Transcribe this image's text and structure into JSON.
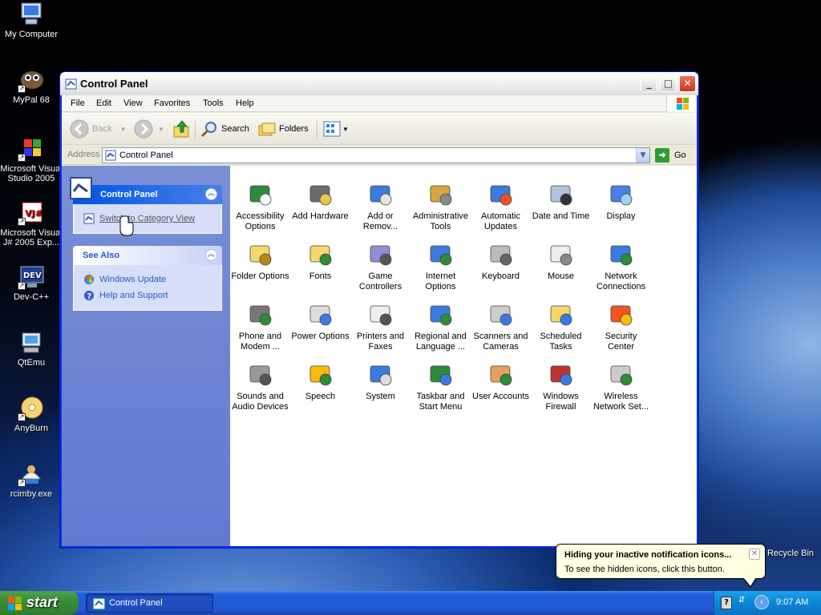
{
  "desktop": {
    "icons": [
      {
        "label": "My Computer",
        "icon": "computer-icon"
      },
      {
        "label": "MyPal 68",
        "icon": "mypal-icon"
      },
      {
        "label": "Microsoft Visual Studio 2005",
        "icon": "visual-studio-icon"
      },
      {
        "label": "Microsoft Visual J# 2005 Exp...",
        "icon": "visual-jsharp-icon"
      },
      {
        "label": "Dev-C++",
        "icon": "devcpp-icon"
      },
      {
        "label": "QtEmu",
        "icon": "qtemu-icon"
      },
      {
        "label": "AnyBurn",
        "icon": "anyburn-icon"
      },
      {
        "label": "rcimby.exe",
        "icon": "exe-icon"
      }
    ],
    "recycle_bin": "Recycle Bin"
  },
  "window": {
    "title": "Control Panel",
    "buttons": {
      "minimize": "_",
      "maximize": "□",
      "close": "✕"
    },
    "menu": [
      "File",
      "Edit",
      "View",
      "Favorites",
      "Tools",
      "Help"
    ],
    "toolbar": {
      "back": "Back",
      "search": "Search",
      "folders": "Folders"
    },
    "address": {
      "label": "Address",
      "value": "Control Panel",
      "go": "Go"
    }
  },
  "taskpane": {
    "control_panel": {
      "title": "Control Panel",
      "link": "Switch to Category View"
    },
    "see_also": {
      "title": "See Also",
      "links": [
        "Windows Update",
        "Help and Support"
      ]
    }
  },
  "items": [
    {
      "label": "Accessibility Options",
      "icon": "accessibility-icon"
    },
    {
      "label": "Add Hardware",
      "icon": "add-hardware-icon"
    },
    {
      "label": "Add or Remov...",
      "icon": "add-remove-programs-icon"
    },
    {
      "label": "Administrative Tools",
      "icon": "administrative-tools-icon"
    },
    {
      "label": "Automatic Updates",
      "icon": "automatic-updates-icon"
    },
    {
      "label": "Date and Time",
      "icon": "date-time-icon"
    },
    {
      "label": "Display",
      "icon": "display-icon"
    },
    {
      "label": "Folder Options",
      "icon": "folder-options-icon"
    },
    {
      "label": "Fonts",
      "icon": "fonts-icon"
    },
    {
      "label": "Game Controllers",
      "icon": "game-controllers-icon"
    },
    {
      "label": "Internet Options",
      "icon": "internet-options-icon"
    },
    {
      "label": "Keyboard",
      "icon": "keyboard-icon"
    },
    {
      "label": "Mouse",
      "icon": "mouse-icon"
    },
    {
      "label": "Network Connections",
      "icon": "network-connections-icon"
    },
    {
      "label": "Phone and Modem ...",
      "icon": "phone-modem-icon"
    },
    {
      "label": "Power Options",
      "icon": "power-options-icon"
    },
    {
      "label": "Printers and Faxes",
      "icon": "printers-faxes-icon"
    },
    {
      "label": "Regional and Language ...",
      "icon": "regional-language-icon"
    },
    {
      "label": "Scanners and Cameras",
      "icon": "scanners-cameras-icon"
    },
    {
      "label": "Scheduled Tasks",
      "icon": "scheduled-tasks-icon"
    },
    {
      "label": "Security Center",
      "icon": "security-center-icon"
    },
    {
      "label": "Sounds and Audio Devices",
      "icon": "sounds-audio-icon"
    },
    {
      "label": "Speech",
      "icon": "speech-icon"
    },
    {
      "label": "System",
      "icon": "system-icon"
    },
    {
      "label": "Taskbar and Start Menu",
      "icon": "taskbar-start-menu-icon"
    },
    {
      "label": "User Accounts",
      "icon": "user-accounts-icon"
    },
    {
      "label": "Windows Firewall",
      "icon": "windows-firewall-icon"
    },
    {
      "label": "Wireless Network Set...",
      "icon": "wireless-network-icon"
    }
  ],
  "balloon": {
    "title": "Hiding your inactive notification icons...",
    "text": "To see the hidden icons, click this button."
  },
  "taskbar": {
    "start": "start",
    "task": "Control Panel",
    "clock": "9:07 AM",
    "help_glyph": "?"
  }
}
